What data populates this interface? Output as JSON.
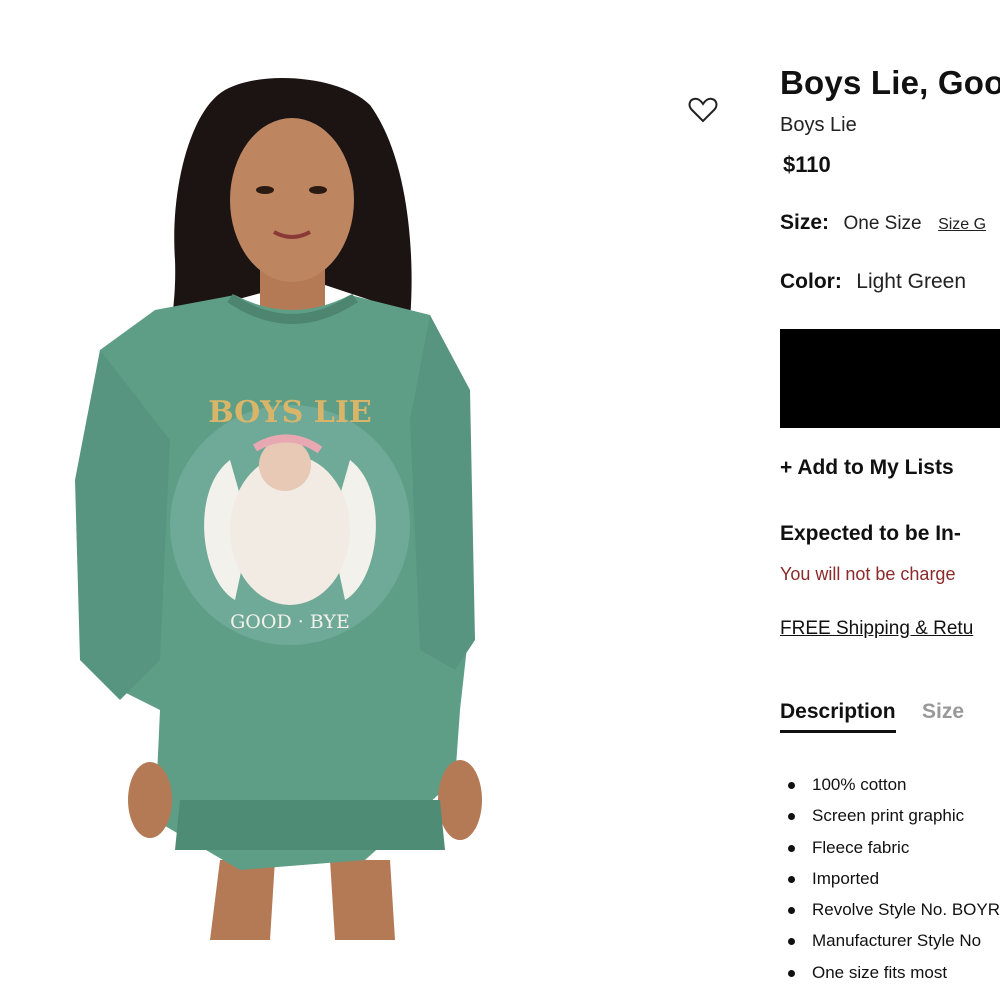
{
  "product": {
    "title": "Boys Lie, Goo",
    "brand": "Boys Lie",
    "price": "$110",
    "size_label": "Size:",
    "size_value": "One Size",
    "size_guide": "Size G",
    "color_label": "Color:",
    "color_value": "Light Green",
    "add_to_lists": "+ Add to My Lists",
    "stock_title": "Expected to be In-",
    "stock_note": "You will not be charge",
    "shipping": "FREE Shipping & Retu"
  },
  "tabs": [
    {
      "label": "Description"
    },
    {
      "label": "Size"
    }
  ],
  "description": [
    "100% cotton",
    "Screen print graphic",
    "Fleece fabric",
    "Imported",
    "Revolve Style No. BOYR",
    "Manufacturer Style No",
    "One size fits most"
  ],
  "graphic": {
    "top_text": "BOYS LIE",
    "bottom_text": "GOOD · BYE"
  },
  "icons": {
    "wishlist": "heart-outline-icon",
    "bullet": "bullet-dot-icon"
  },
  "colors": {
    "sweatshirt": "#5f9e86",
    "button": "#000000",
    "stock_note": "#8a2a2a",
    "muted_tab": "#999999"
  }
}
